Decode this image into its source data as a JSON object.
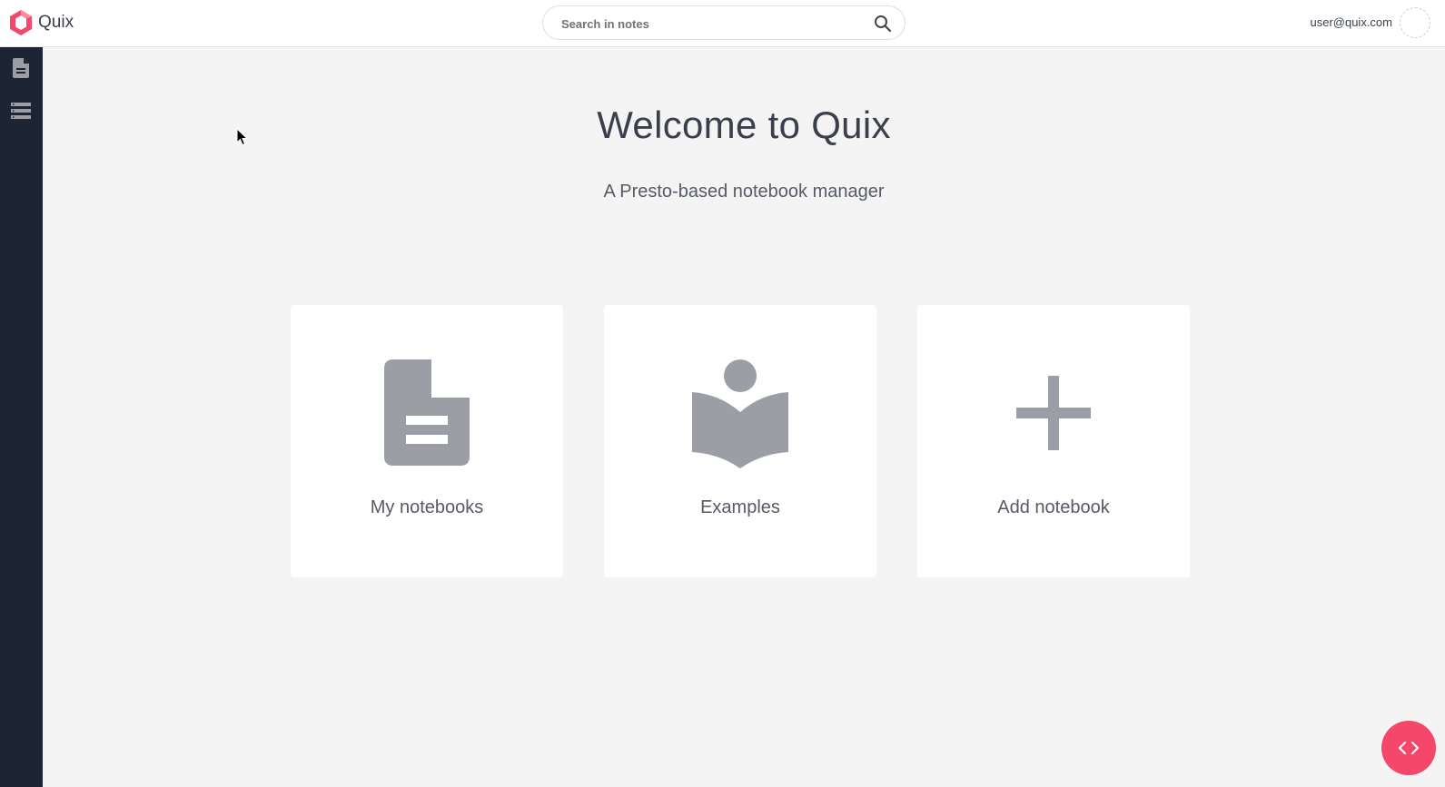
{
  "app": {
    "name": "Quix"
  },
  "search": {
    "placeholder": "Search in notes",
    "icon": "search-icon"
  },
  "user": {
    "email": "user@quix.com"
  },
  "sidebar": {
    "items": [
      {
        "icon": "notebook-icon"
      },
      {
        "icon": "database-icon"
      }
    ]
  },
  "welcome": {
    "title": "Welcome to Quix",
    "subtitle": "A Presto-based notebook manager"
  },
  "cards": [
    {
      "label": "My notebooks",
      "icon": "document-icon"
    },
    {
      "label": "Examples",
      "icon": "reading-book-icon"
    },
    {
      "label": "Add notebook",
      "icon": "plus-icon"
    }
  ],
  "fab": {
    "icon": "code-icon"
  },
  "colors": {
    "accent": "#f5476a",
    "sidebar": "#1d2433",
    "icon_gray": "#9b9ea4",
    "background": "#f4f4f4"
  }
}
